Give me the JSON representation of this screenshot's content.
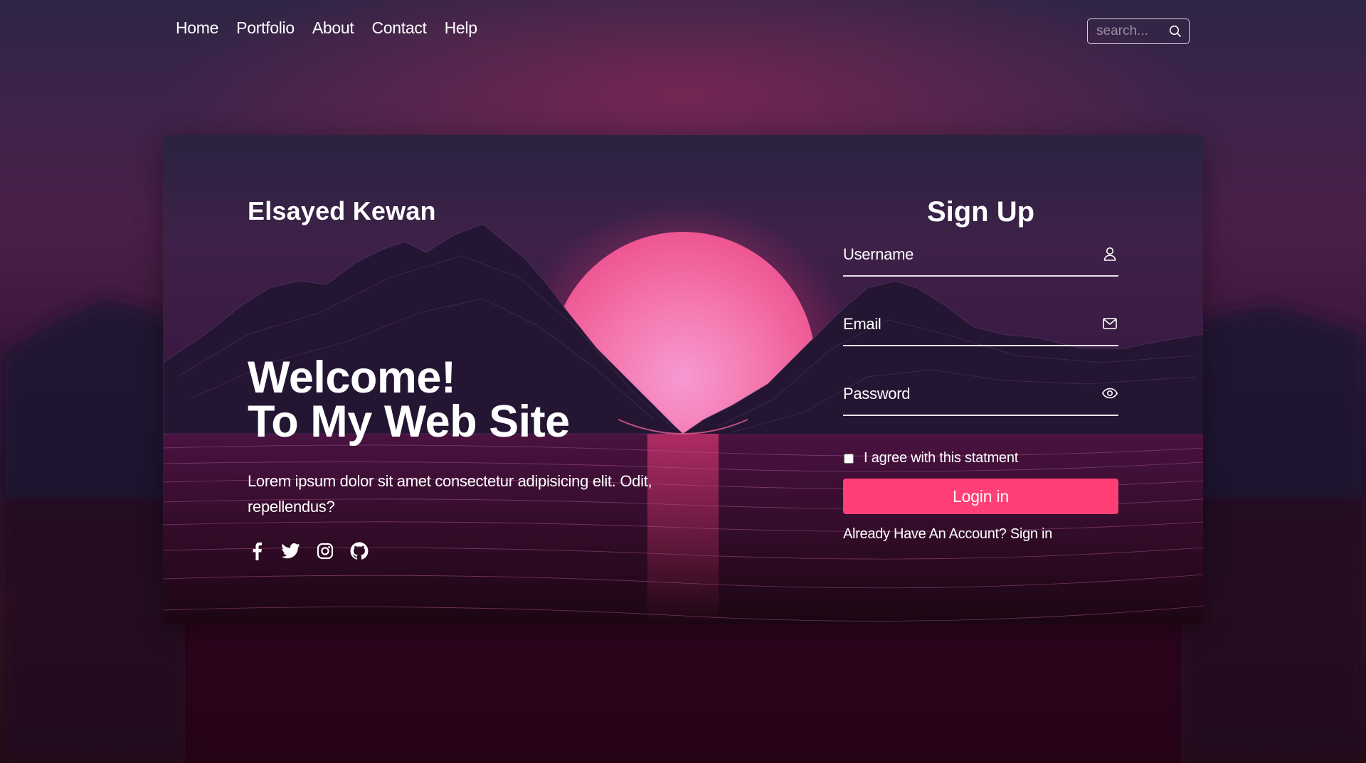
{
  "nav": {
    "items": [
      {
        "label": "Home"
      },
      {
        "label": "Portfolio"
      },
      {
        "label": "About"
      },
      {
        "label": "Contact"
      },
      {
        "label": "Help"
      }
    ]
  },
  "search": {
    "placeholder": "search...",
    "icon": "search-icon"
  },
  "hero": {
    "brand": "Elsayed Kewan",
    "welcome_line1": "Welcome!",
    "welcome_line2": "To My Web Site",
    "lead": "Lorem ipsum dolor sit amet consectetur adipisicing elit. Odit, repellendus?",
    "socials": [
      {
        "icon": "facebook-icon"
      },
      {
        "icon": "twitter-icon"
      },
      {
        "icon": "instagram-icon"
      },
      {
        "icon": "github-icon"
      }
    ]
  },
  "signup": {
    "title": "Sign Up",
    "username_placeholder": "Username",
    "email_placeholder": "Email",
    "password_placeholder": "Password",
    "agree_label": "I agree with this statment",
    "agree_checked": false,
    "button_label": "Login in",
    "signin_prompt": "Already Have An Account?",
    "signin_link": "Sign in"
  },
  "colors": {
    "accent": "#ff3f75",
    "text": "#ffffff",
    "field_line": "#e9e3ec"
  }
}
